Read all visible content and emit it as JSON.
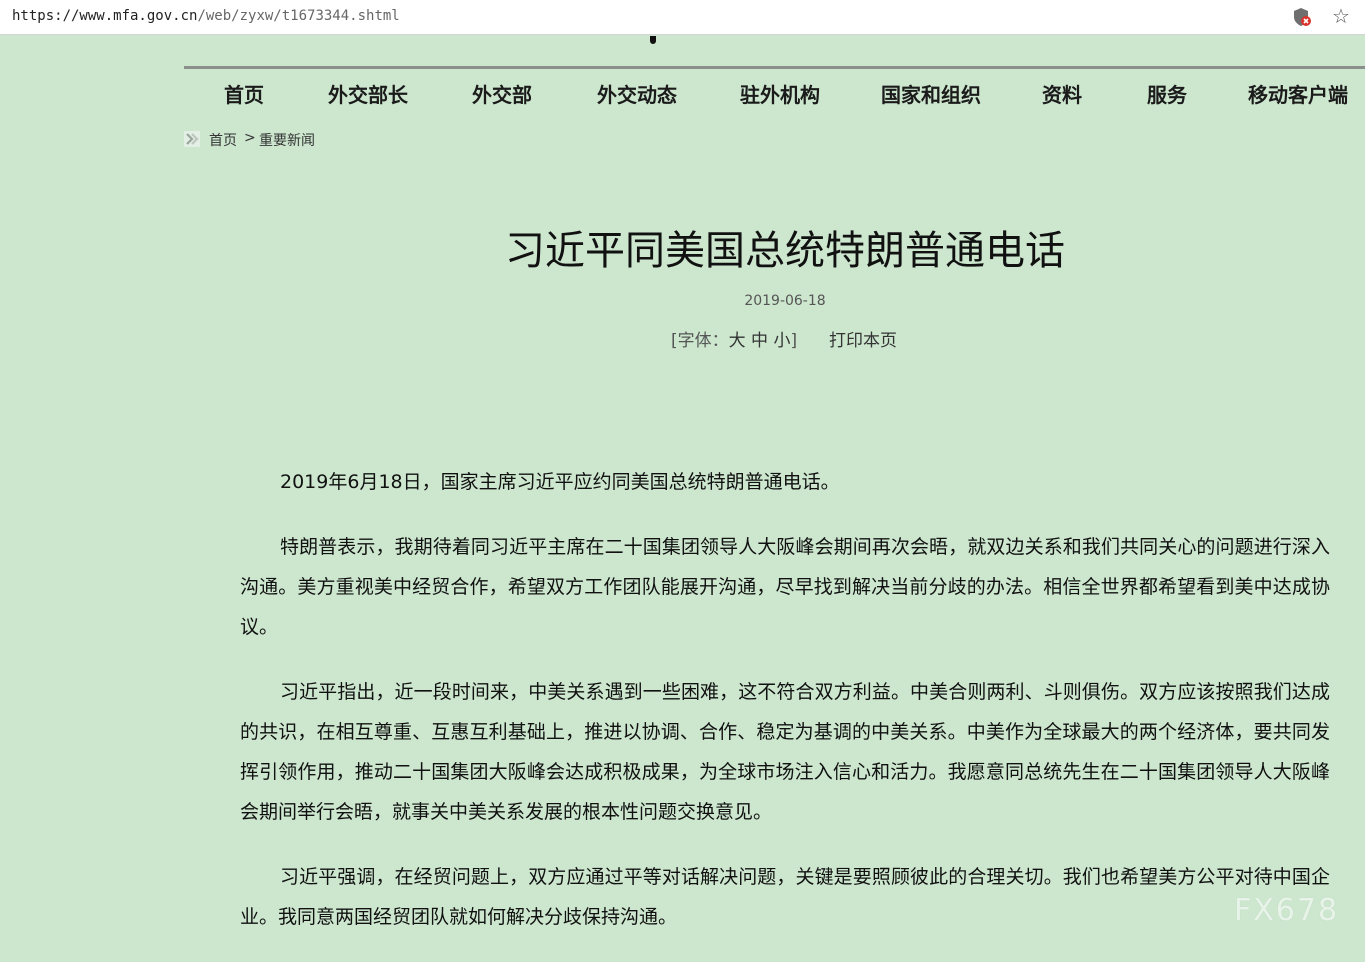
{
  "browser": {
    "url_scheme_host": "https://www.mfa.gov.cn",
    "url_path": "/web/zyxw/t1673344.shtml",
    "extension_icon": "shield-x-icon",
    "bookmark_icon": "star-icon"
  },
  "nav": {
    "items": [
      "首页",
      "外交部长",
      "外交部",
      "外交动态",
      "驻外机构",
      "国家和组织",
      "资料",
      "服务",
      "移动客户端"
    ]
  },
  "breadcrumb": {
    "home": "首页",
    "separator": ">",
    "current": "重要新闻"
  },
  "article": {
    "title": "习近平同美国总统特朗普通电话",
    "date": "2019-06-18",
    "font_label_prefix": "[字体：",
    "font_large": "大",
    "font_medium": "中",
    "font_small": "小",
    "font_label_suffix": "]",
    "print_label": "打印本页",
    "paragraphs": [
      "2019年6月18日，国家主席习近平应约同美国总统特朗普通电话。",
      "特朗普表示，我期待着同习近平主席在二十国集团领导人大阪峰会期间再次会晤，就双边关系和我们共同关心的问题进行深入沟通。美方重视美中经贸合作，希望双方工作团队能展开沟通，尽早找到解决当前分歧的办法。相信全世界都希望看到美中达成协议。",
      "习近平指出，近一段时间来，中美关系遇到一些困难，这不符合双方利益。中美合则两利、斗则俱伤。双方应该按照我们达成的共识，在相互尊重、互惠互利基础上，推进以协调、合作、稳定为基调的中美关系。中美作为全球最大的两个经济体，要共同发挥引领作用，推动二十国集团大阪峰会达成积极成果，为全球市场注入信心和活力。我愿意同总统先生在二十国集团领导人大阪峰会期间举行会晤，就事关中美关系发展的根本性问题交换意见。",
      "习近平强调，在经贸问题上，双方应通过平等对话解决问题，关键是要照顾彼此的合理关切。我们也希望美方公平对待中国企业。我同意两国经贸团队就如何解决分歧保持沟通。"
    ]
  },
  "watermark": "FX678"
}
